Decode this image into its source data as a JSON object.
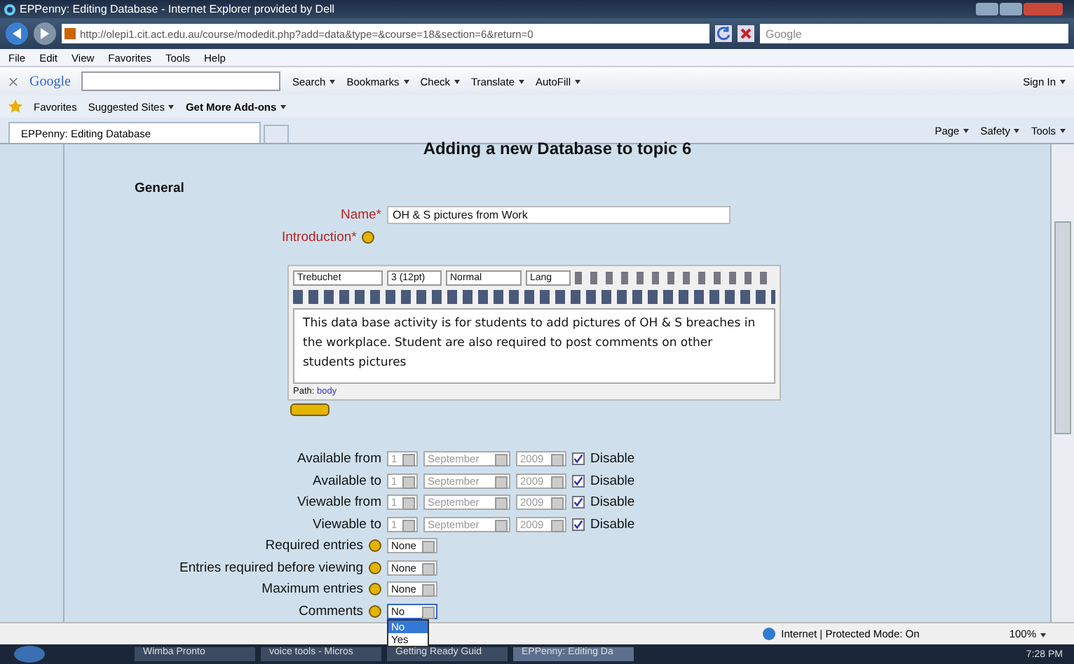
{
  "window": {
    "title": "EPPenny: Editing Database - Internet Explorer provided by Dell"
  },
  "address_bar": {
    "url": "http://olepi1.cit.act.edu.au/course/modedit.php?add=data&type=&course=18&section=6&return=0",
    "search_placeholder": "Google"
  },
  "menu": [
    "File",
    "Edit",
    "View",
    "Favorites",
    "Tools",
    "Help"
  ],
  "google_toolbar": {
    "logo": "Google",
    "items": [
      "Search",
      "Bookmarks",
      "Check",
      "Translate",
      "AutoFill"
    ],
    "sign_in": "Sign In"
  },
  "favorites_bar": {
    "favorites": "Favorites",
    "links": [
      "Suggested Sites",
      "Get More Add-ons"
    ]
  },
  "tabs": [
    {
      "label": "EPPenny: Editing Database",
      "selected": true
    }
  ],
  "command_bar": [
    "Page",
    "Safety",
    "Tools"
  ],
  "page": {
    "heading": "Adding a new Database to topic 6",
    "section": "General",
    "name": {
      "label": "Name",
      "required": "*",
      "value": "OH & S pictures from Work"
    },
    "introduction": {
      "label": "Introduction",
      "required": "*"
    },
    "editor": {
      "font": "Trebuchet",
      "size": "3 (12pt)",
      "format": "Normal",
      "lang": "Lang",
      "text": "This data base activity is for students to add pictures of OH & S breaches in the workplace. Student are also required to post comments on other students pictures",
      "path_label": "Path:",
      "path": "body"
    },
    "date_rows": [
      {
        "label": "Available from",
        "day": "1",
        "month": "September",
        "year": "2009",
        "disable_label": "Disable",
        "checked": true
      },
      {
        "label": "Available to",
        "day": "1",
        "month": "September",
        "year": "2009",
        "disable_label": "Disable",
        "checked": true
      },
      {
        "label": "Viewable from",
        "day": "1",
        "month": "September",
        "year": "2009",
        "disable_label": "Disable",
        "checked": true
      },
      {
        "label": "Viewable to",
        "day": "1",
        "month": "September",
        "year": "2009",
        "disable_label": "Disable",
        "checked": true
      }
    ],
    "select_rows": [
      {
        "label": "Required entries",
        "value": "None",
        "expanded": false
      },
      {
        "label": "Entries required before viewing",
        "value": "None",
        "expanded": false
      },
      {
        "label": "Maximum entries",
        "value": "None",
        "expanded": false
      },
      {
        "label": "Comments",
        "value": "No",
        "expanded": true,
        "options": [
          {
            "label": "No",
            "selected": true
          },
          {
            "label": "Yes",
            "selected": false
          }
        ]
      }
    ]
  },
  "status_bar": {
    "zone": "Internet | Protected Mode: On",
    "zoom": "100%"
  },
  "taskbar": {
    "items": [
      {
        "label": "Wimba Pronto",
        "selected": false
      },
      {
        "label": "voice tools - Micros",
        "selected": false
      },
      {
        "label": "Getting Ready Guid",
        "selected": false
      },
      {
        "label": "EPPenny: Editing Da",
        "selected": true
      }
    ],
    "clock": "7:28 PM"
  }
}
